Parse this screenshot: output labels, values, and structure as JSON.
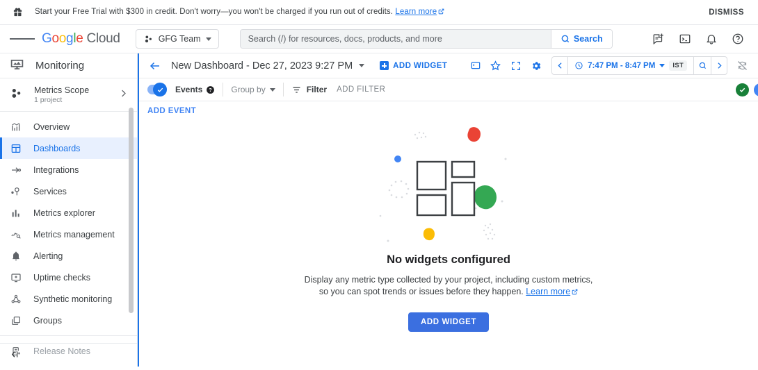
{
  "promo": {
    "icon": "gift-icon",
    "text": "Start your Free Trial with $300 in credit. Don't worry—you won't be charged if you run out of credits.",
    "link": "Learn more",
    "dismiss": "DISMISS"
  },
  "header": {
    "menu_icon": "hamburger-icon",
    "logo": {
      "g1": "G",
      "o1": "o",
      "o2": "o",
      "g2": "g",
      "l": "l",
      "e": "e",
      "cloud": "Cloud"
    },
    "project": {
      "label": "GFG Team",
      "icon": "project-icon"
    },
    "search": {
      "placeholder": "Search (/) for resources, docs, products, and more",
      "value": "",
      "button": "Search",
      "icon": "search-icon"
    },
    "icons": [
      "feedback-icon",
      "cloud-shell-icon",
      "notifications-bell-icon",
      "help-icon"
    ]
  },
  "sidebar": {
    "product": {
      "title": "Monitoring",
      "icon": "monitoring-icon"
    },
    "scope": {
      "title": "Metrics Scope",
      "subtitle": "1 project",
      "icon": "metrics-scope-icon",
      "chevron": "chevron-right-icon"
    },
    "items": [
      {
        "label": "Overview",
        "icon": "overview-icon",
        "active": false
      },
      {
        "label": "Dashboards",
        "icon": "dashboards-icon",
        "active": true
      },
      {
        "label": "Integrations",
        "icon": "integrations-icon",
        "active": false
      },
      {
        "label": "Services",
        "icon": "services-icon",
        "active": false
      },
      {
        "label": "Metrics explorer",
        "icon": "metrics-explorer-icon",
        "active": false
      },
      {
        "label": "Metrics management",
        "icon": "metrics-management-icon",
        "active": false
      },
      {
        "label": "Alerting",
        "icon": "alerting-bell-icon",
        "active": false
      },
      {
        "label": "Uptime checks",
        "icon": "uptime-checks-icon",
        "active": false
      },
      {
        "label": "Synthetic monitoring",
        "icon": "synthetic-monitoring-icon",
        "active": false
      },
      {
        "label": "Groups",
        "icon": "groups-icon",
        "active": false
      }
    ],
    "release_notes": {
      "label": "Release Notes",
      "icon": "release-notes-icon"
    },
    "collapse": {
      "icon": "collapse-panel-icon"
    }
  },
  "dashboard": {
    "back_icon": "back-arrow-icon",
    "title": "New Dashboard - Dec 27, 2023 9:27 PM",
    "add_widget_link": "ADD WIDGET",
    "toolbar_icons": [
      "notes-panel-icon",
      "star-icon",
      "fullscreen-icon",
      "settings-gear-icon"
    ],
    "timerange": {
      "prev_icon": "chevron-left-icon",
      "clock_icon": "clock-icon",
      "value": "7:47 PM - 8:47 PM",
      "timezone": "IST",
      "search_icon": "search-icon",
      "next_icon": "chevron-right-icon"
    },
    "autorefresh_icon": "refresh-off-icon"
  },
  "filterbar": {
    "events_toggle": {
      "label": "Events",
      "on": true,
      "help_icon": "help-filled-icon"
    },
    "group_by": "Group by",
    "filter": "Filter",
    "add_filter": "ADD FILTER",
    "status_icon": "status-ok-check-icon"
  },
  "eventbar": {
    "add_event": "ADD EVENT"
  },
  "empty_state": {
    "illustration": "no-widgets-illustration",
    "title": "No widgets configured",
    "description_line1": "Display any metric type collected by your project, including custom metrics,",
    "description_line2": "so you can spot trends or issues before they happen.",
    "learn_more": "Learn more",
    "button": "ADD WIDGET"
  },
  "colors": {
    "blue": "#1a73e8",
    "active_bg": "#e8f0fe",
    "green": "#34a853",
    "red": "#ea4335",
    "yellow": "#fbbc05",
    "button_blue": "#3b6fe0",
    "status_green": "#188038"
  }
}
